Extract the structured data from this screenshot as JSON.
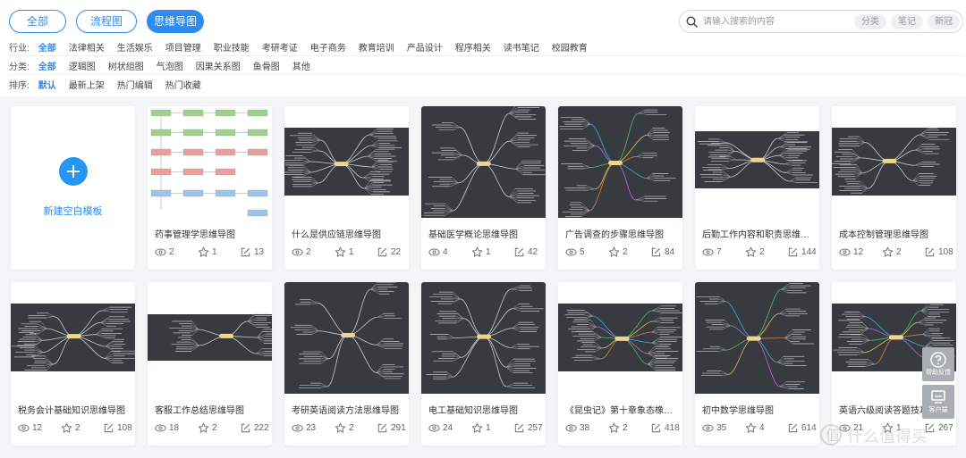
{
  "tabs": [
    {
      "label": "全部",
      "active": false
    },
    {
      "label": "流程图",
      "active": false
    },
    {
      "label": "思维导图",
      "active": true
    }
  ],
  "search": {
    "placeholder": "请输入搜索的内容",
    "chips": [
      "分类",
      "笔记",
      "新冠"
    ]
  },
  "filters": {
    "industry": {
      "label": "行业:",
      "options": [
        "全部",
        "法律相关",
        "生活娱乐",
        "项目管理",
        "职业技能",
        "考研考证",
        "电子商务",
        "教育培训",
        "产品设计",
        "程序相关",
        "读书笔记",
        "校园教育"
      ],
      "selected": 0
    },
    "category": {
      "label": "分类:",
      "options": [
        "全部",
        "逻辑图",
        "树状组图",
        "气泡图",
        "因果关系图",
        "鱼骨图",
        "其他"
      ],
      "selected": 0
    },
    "sort": {
      "label": "排序:",
      "options": [
        "默认",
        "最新上架",
        "热门编辑",
        "热门收藏"
      ],
      "selected": 0
    }
  },
  "blank_card": {
    "label": "新建空白模板"
  },
  "templates": [
    {
      "title": "药事管理学思维导图",
      "views": "2",
      "likes": "1",
      "edits": "13",
      "thumb": "flow"
    },
    {
      "title": "什么是供应链思维导图",
      "views": "2",
      "likes": "1",
      "edits": "22",
      "thumb": "band"
    },
    {
      "title": "基础医学概论思维导图",
      "views": "4",
      "likes": "1",
      "edits": "42",
      "thumb": "full"
    },
    {
      "title": "广告调查的步骤思维导图",
      "views": "5",
      "likes": "2",
      "edits": "84",
      "thumb": "full-color"
    },
    {
      "title": "后勤工作内容和职责思维导图",
      "views": "7",
      "likes": "2",
      "edits": "144",
      "thumb": "wide"
    },
    {
      "title": "成本控制管理思维导图",
      "views": "12",
      "likes": "2",
      "edits": "108",
      "thumb": "band"
    },
    {
      "title": "税务会计基础知识思维导图",
      "views": "12",
      "likes": "2",
      "edits": "108",
      "thumb": "band"
    },
    {
      "title": "客服工作总结思维导图",
      "views": "18",
      "likes": "2",
      "edits": "222",
      "thumb": "thin"
    },
    {
      "title": "考研英语阅读方法思维导图",
      "views": "23",
      "likes": "2",
      "edits": "291",
      "thumb": "full"
    },
    {
      "title": "电工基础知识思维导图",
      "views": "24",
      "likes": "1",
      "edits": "257",
      "thumb": "full-fan"
    },
    {
      "title": "《昆虫记》第十章象态橡栗...",
      "views": "38",
      "likes": "2",
      "edits": "418",
      "thumb": "band-color"
    },
    {
      "title": "初中数学思维导图",
      "views": "35",
      "likes": "4",
      "edits": "614",
      "thumb": "full-color"
    },
    {
      "title": "英语六级阅读答题技巧思维...",
      "views": "21",
      "likes": "1",
      "edits": "267",
      "thumb": "band-green"
    }
  ],
  "float_buttons": [
    "帮助反馈",
    "客户端"
  ],
  "colors": {
    "accent": "#2e8bf0",
    "plus": "#2496f4",
    "map_bg": "#373b3f"
  }
}
